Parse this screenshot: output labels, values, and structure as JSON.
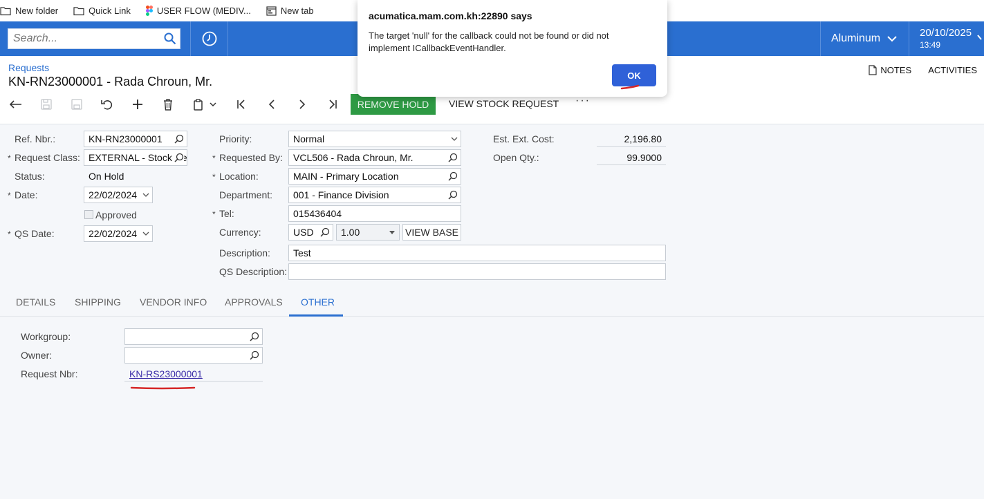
{
  "bookmarks": [
    {
      "label": "New folder",
      "icon": "folder-icon"
    },
    {
      "label": "Quick Link",
      "icon": "folder-icon"
    },
    {
      "label": "USER FLOW (MEDIV...",
      "icon": "figma-icon"
    },
    {
      "label": "New tab",
      "icon": "new-tab-icon"
    }
  ],
  "header": {
    "search_placeholder": "Search...",
    "theme": "Aluminum",
    "date": "20/10/2025",
    "time": "13:49",
    "brand_color": "#2a6fd0"
  },
  "page": {
    "breadcrumb": "Requests",
    "title": "KN-RN23000001 - Rada Chroun, Mr.",
    "notes": "NOTES",
    "activities": "ACTIVITIES"
  },
  "toolbar": {
    "remove_hold": "REMOVE HOLD",
    "view_stock_request": "VIEW STOCK REQUEST",
    "more": "···"
  },
  "form": {
    "ref_nbr_label": "Ref. Nbr.:",
    "ref_nbr": "KN-RN23000001",
    "request_class_label": "Request Class:",
    "request_class": "EXTERNAL - Stock Request",
    "status_label": "Status:",
    "status": "On Hold",
    "date_label": "Date:",
    "date": "22/02/2024",
    "approved_label": "Approved",
    "qs_date_label": "QS Date:",
    "qs_date": "22/02/2024",
    "priority_label": "Priority:",
    "priority": "Normal",
    "requested_by_label": "Requested By:",
    "requested_by": "VCL506 - Rada Chroun, Mr.",
    "location_label": "Location:",
    "location": "MAIN - Primary Location",
    "department_label": "Department:",
    "department": "001 - Finance Division",
    "tel_label": "Tel:",
    "tel": "015436404",
    "currency_label": "Currency:",
    "currency": "USD",
    "rate": "1.00",
    "view_base": "VIEW BASE",
    "description_label": "Description:",
    "description": "Test",
    "qs_description_label": "QS Description:",
    "qs_description": "",
    "est_ext_cost_label": "Est. Ext. Cost:",
    "est_ext_cost": "2,196.80",
    "open_qty_label": "Open Qty.:",
    "open_qty": "99.9000"
  },
  "tabs": [
    "DETAILS",
    "SHIPPING",
    "VENDOR INFO",
    "APPROVALS",
    "OTHER"
  ],
  "other_tab": {
    "workgroup_label": "Workgroup:",
    "workgroup": "",
    "owner_label": "Owner:",
    "owner": "",
    "request_nbr_label": "Request Nbr:",
    "request_nbr": "KN-RS23000001"
  },
  "dialog": {
    "title": "acumatica.mam.com.kh:22890 says",
    "message": "The target 'null' for the callback could not be found or did not implement ICallbackEventHandler.",
    "ok": "OK"
  }
}
